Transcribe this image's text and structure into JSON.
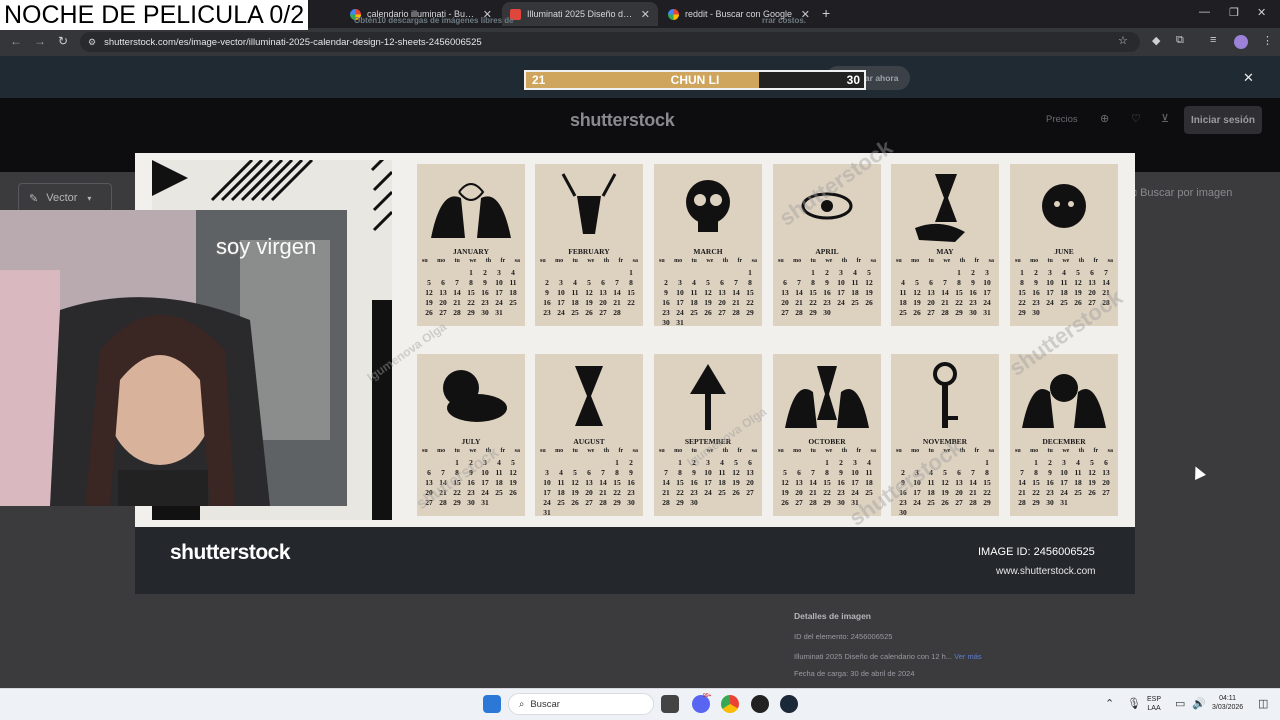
{
  "overlay": {
    "stream_title": "NOCHE DE PELICULA 0/2",
    "bar": {
      "left_value": "21",
      "name": "CHUN LI",
      "right_value": "30",
      "fill_fraction": 0.69
    },
    "cam_caption": "soy virgen"
  },
  "browser": {
    "tabs": [
      {
        "title": "calendario illuminati - Buscar con Google",
        "icon": "google-icon",
        "active": false
      },
      {
        "title": "Illuminati 2025 Diseño de calendario",
        "icon": "shutterstock-icon",
        "active": true
      },
      {
        "title": "reddit - Buscar con Google",
        "icon": "google-icon",
        "active": false
      }
    ],
    "url": "shutterstock.com/es/image-vector/illuminati-2025-calendar-design-12-sheets-2456006525"
  },
  "site": {
    "promo_text": "Obtén10 descargas de imágenes libres de",
    "promo_text_tail": "rrar costos.",
    "promo_button": "Comprar ahora",
    "logo": "shutterstock",
    "precios": "Precios",
    "login": "Iniciar sesión",
    "vector_filter": "Vector",
    "search_by_image": "Buscar por imagen",
    "footer_logo": "shutterstock",
    "image_id_label": "IMAGE ID: 2456006525",
    "footer_url": "www.shutterstock.com",
    "details": {
      "title": "Detalles de imagen",
      "element_id": "ID del elemento: 2456006525",
      "description": "Illuminati 2025 Diseño de calendario con 12 h...",
      "ver_mas": "Ver más",
      "upload_date": "Fecha de carga: 30 de abril de 2024"
    }
  },
  "calendar": {
    "dow": [
      "su",
      "mo",
      "tu",
      "we",
      "th",
      "fr",
      "sa"
    ],
    "months": [
      {
        "name": "JANUARY",
        "icon": "hands-heart-icon",
        "offset": 3,
        "days": 31
      },
      {
        "name": "FEBRUARY",
        "icon": "deer-head-icon",
        "offset": 6,
        "days": 28
      },
      {
        "name": "MARCH",
        "icon": "skull-icon",
        "offset": 6,
        "days": 31
      },
      {
        "name": "APRIL",
        "icon": "eye-icon",
        "offset": 2,
        "days": 30
      },
      {
        "name": "MAY",
        "icon": "hourglass-hand-icon",
        "offset": 4,
        "days": 31
      },
      {
        "name": "JUNE",
        "icon": "sun-eyes-icon",
        "offset": 0,
        "days": 30
      },
      {
        "name": "JULY",
        "icon": "moon-clouds-icon",
        "offset": 2,
        "days": 31
      },
      {
        "name": "AUGUST",
        "icon": "hourglass-icon",
        "offset": 5,
        "days": 31
      },
      {
        "name": "SEPTEMBER",
        "icon": "eye-pyramid-key-icon",
        "offset": 1,
        "days": 30
      },
      {
        "name": "OCTOBER",
        "icon": "hands-hourglass-icon",
        "offset": 3,
        "days": 31
      },
      {
        "name": "NOVEMBER",
        "icon": "key-icon",
        "offset": 6,
        "days": 30
      },
      {
        "name": "DECEMBER",
        "icon": "hands-skull-icon",
        "offset": 1,
        "days": 31
      }
    ],
    "watermark": "shutterstock",
    "artist_watermark": "Igumenova Olga"
  },
  "taskbar": {
    "search_placeholder": "Buscar",
    "lang_top": "ESP",
    "lang_bottom": "LAA",
    "time": "04:11",
    "date": "3/03/2026",
    "chat_badge": "99+"
  }
}
